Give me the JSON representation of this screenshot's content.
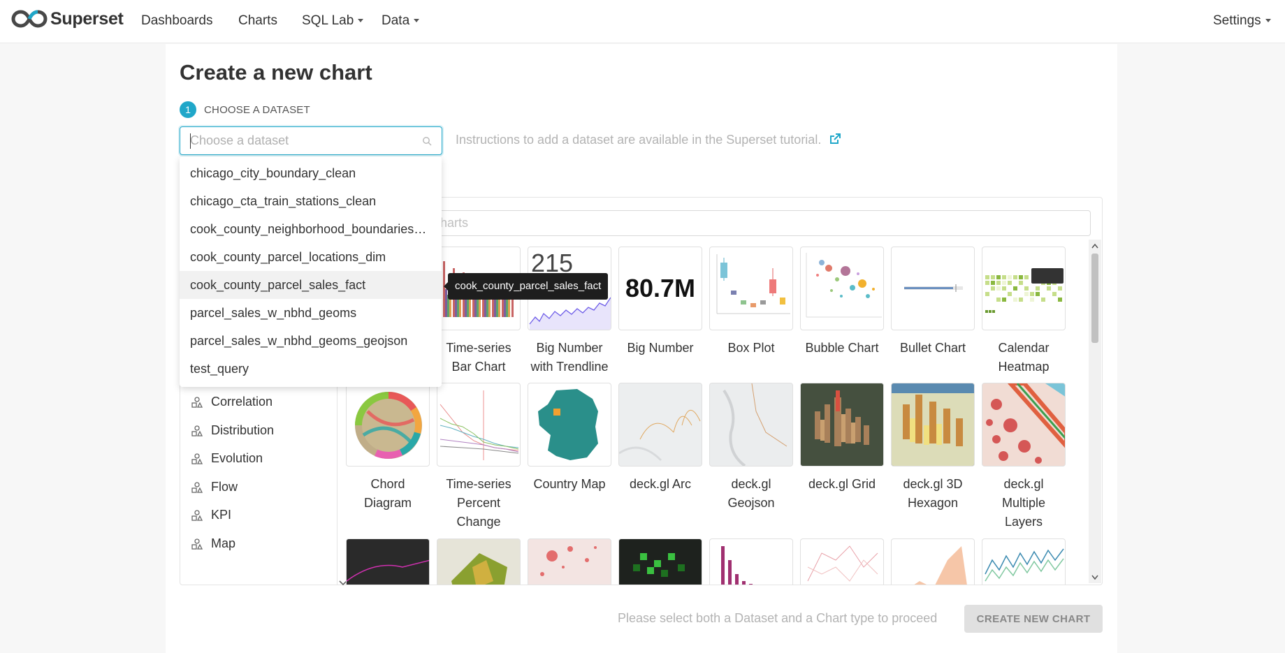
{
  "navbar": {
    "brand": "Superset",
    "items": [
      {
        "label": "Dashboards"
      },
      {
        "label": "Charts"
      },
      {
        "label": "SQL Lab"
      },
      {
        "label": "Data"
      }
    ],
    "settings": "Settings"
  },
  "page": {
    "title": "Create a new chart",
    "step_number": "1",
    "step_label": "CHOOSE A DATASET",
    "dataset_placeholder": "Choose a dataset",
    "instructions": "Instructions to add a dataset are available in the Superset tutorial.",
    "chart_search_placeholder": "charts",
    "footer_message": "Please select both a Dataset and a Chart type to proceed",
    "create_button": "CREATE NEW CHART"
  },
  "dropdown": {
    "options": [
      "chicago_city_boundary_clean",
      "chicago_cta_train_stations_clean",
      "cook_county_neighborhood_boundaries…",
      "cook_county_parcel_locations_dim",
      "cook_county_parcel_sales_fact",
      "parcel_sales_w_nbhd_geoms",
      "parcel_sales_w_nbhd_geoms_geojson",
      "test_query"
    ],
    "hovered_index": 4,
    "tooltip": "cook_county_parcel_sales_fact"
  },
  "categories": [
    "Correlation",
    "Distribution",
    "Evolution",
    "Flow",
    "KPI",
    "Map"
  ],
  "chart_types": {
    "row1": [
      {
        "label": "Time-series Bar Chart"
      },
      {
        "label": "Big Number with Trendline",
        "thumb_text": "215"
      },
      {
        "label": "Big Number",
        "thumb_text": "80.7M"
      },
      {
        "label": "Box Plot"
      },
      {
        "label": "Bubble Chart"
      },
      {
        "label": "Bullet Chart"
      },
      {
        "label": "Calendar Heatmap"
      }
    ],
    "row2": [
      {
        "label": "Chord Diagram"
      },
      {
        "label": "Time-series Percent Change"
      },
      {
        "label": "Country Map"
      },
      {
        "label": "deck.gl Arc"
      },
      {
        "label": "deck.gl Geojson"
      },
      {
        "label": "deck.gl Grid"
      },
      {
        "label": "deck.gl 3D Hexagon"
      },
      {
        "label": "deck.gl Multiple Layers"
      }
    ]
  },
  "colors": {
    "accent": "#20a7c9",
    "text": "#323232",
    "muted": "#b3b3b3"
  }
}
